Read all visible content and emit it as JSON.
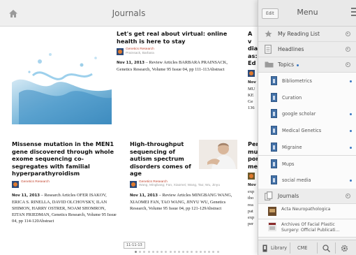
{
  "header": {
    "title": "Journals",
    "home_icon": "home-icon"
  },
  "articles": [
    {
      "title": "Let's get real about virtual: online health is here to stay",
      "source": "Genetics Research",
      "authors": "Prainsack, Barbara",
      "date": "Nov 11, 2013",
      "meta": " – Review Articles BARBARA PRAINSACK, Genetics Research, Volume 95 Issue 04, pp 111-113Abstract"
    },
    {
      "title": "Missense mutation in the MEN1 gene discovered through whole exome sequencing co-segregates with familial hyperparathyroidism",
      "source": "Genetics Research",
      "date": "Nov 11, 2013",
      "meta": " – Research Articles OFER ISAKOV, ERICA S. RINELLA, DAVID OLCHOVSKY, ILAN SHIMON, HARRY OSTRER, NOAM SHOMRON, EITAN FRIEDMAN, Genetics Research, Volume 95 Issue 04, pp 114-120Abstract"
    },
    {
      "title": "High-throughput sequencing of autism spectrum disorders comes of age",
      "source": "Genetics Research",
      "authors": "Wang, Mingbang; Fan, Xiaomei; Wang, Tao; Wu, Jinyu",
      "date": "Nov 11, 2013",
      "meta": " – Review Articles MINGBANG WANG, XIAOMEI FAN, TAO WANG, JINYU WU, Genetics Research, Volume 95 Issue 04, pp 121-129Abstract"
    }
  ],
  "partial_articles": {
    "top_title_fragments": [
      "A v",
      "dia",
      "as:",
      "Ed"
    ],
    "top_meta_fragments": [
      "Nov",
      "MU",
      "KE",
      "Ge",
      "136"
    ],
    "bottom_title_fragments": [
      "Per",
      "mu",
      "por",
      "me"
    ],
    "bottom_meta_fragments": [
      "Nov",
      "exp",
      "tho",
      "rea",
      "pat",
      "exp",
      "per"
    ]
  },
  "pagination": {
    "label": "11-11-13",
    "dot_count": 20,
    "active_index": 0
  },
  "menu": {
    "edit_label": "Edit",
    "title": "Menu",
    "my_reading_list": "My Reading List",
    "headlines": "Headlines",
    "topics": "Topics",
    "topic_items": [
      "Bibliometrics",
      "Curation",
      "google scholar",
      "Medical Genetics",
      "Migraine",
      "Mups",
      "social media"
    ],
    "topic_unread": [
      true,
      false,
      true,
      true,
      true,
      false,
      true
    ],
    "journals": "Journals",
    "journal_items": [
      "Acta Neuropathologica",
      "Archives Of Facial Plastic Surgery: Official Publicati..."
    ],
    "footer": {
      "library": "Library",
      "cme": "CME"
    }
  },
  "colors": {
    "accent_blue": "#3b78c2",
    "source_red": "#c2452f",
    "topic_icon": "#4472a8"
  }
}
